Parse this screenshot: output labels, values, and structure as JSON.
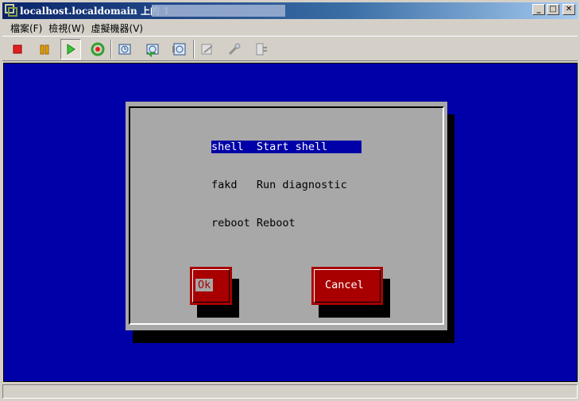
{
  "window": {
    "title": "localhost.localdomain 上的 1",
    "minimize_label": "_",
    "maximize_label": "□",
    "close_label": "✕"
  },
  "menu": {
    "items": [
      "檔案(F)",
      "檢視(W)",
      "虛擬機器(V)"
    ]
  },
  "toolbar": {
    "buttons": [
      {
        "icon": "stop-icon",
        "color": "#e02020"
      },
      {
        "icon": "pause-icon",
        "color": "#e0a000"
      },
      {
        "icon": "play-icon",
        "color": "#20a020",
        "pressed": true
      },
      {
        "icon": "reset-icon",
        "color": "#30a030"
      },
      {
        "icon": "snapshot-icon"
      },
      {
        "icon": "revert-snapshot-icon"
      },
      {
        "icon": "snapshot-manager-icon"
      },
      {
        "icon": "vm-settings-icon",
        "disabled": true
      },
      {
        "icon": "vm-tools-icon",
        "disabled": true
      },
      {
        "icon": "vm-connect-icon",
        "disabled": true
      }
    ]
  },
  "console": {
    "background": "#0000a8",
    "dialog": {
      "options": [
        {
          "key": "shell",
          "desc": "Start shell",
          "selected": true
        },
        {
          "key": "fakd",
          "desc": "Run diagnostic",
          "selected": false
        },
        {
          "key": "reboot",
          "desc": "Reboot",
          "selected": false
        }
      ],
      "ok_label": "Ok",
      "cancel_label": "Cancel"
    }
  },
  "colors": {
    "accent": "#0a246a",
    "button_red": "#a80000",
    "dialog_gray": "#a8a8a8"
  }
}
